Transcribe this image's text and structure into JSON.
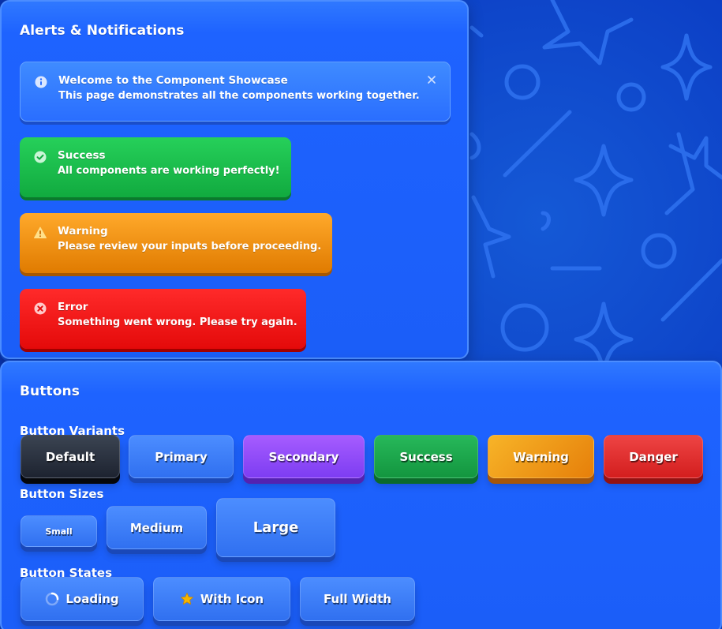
{
  "alerts_panel": {
    "title": "Alerts & Notifications",
    "alerts": [
      {
        "type": "info",
        "icon": "info-icon",
        "title": "Welcome to the Component Showcase",
        "message": "This page demonstrates all the components working together.",
        "dismissible": true
      },
      {
        "type": "success",
        "icon": "check-circle-icon",
        "title": "Success",
        "message": "All components are working perfectly!"
      },
      {
        "type": "warning",
        "icon": "warning-triangle-icon",
        "title": "Warning",
        "message": "Please review your inputs before proceeding."
      },
      {
        "type": "error",
        "icon": "x-circle-icon",
        "title": "Error",
        "message": "Something went wrong. Please try again."
      }
    ]
  },
  "buttons_panel": {
    "title": "Buttons",
    "variants": {
      "heading": "Button Variants",
      "buttons": [
        "Default",
        "Primary",
        "Secondary",
        "Success",
        "Warning",
        "Danger"
      ]
    },
    "sizes": {
      "heading": "Button Sizes",
      "buttons": [
        "Small",
        "Medium",
        "Large"
      ]
    },
    "states": {
      "heading": "Button States",
      "buttons": [
        {
          "label": "Loading",
          "icon": "spinner-icon"
        },
        {
          "label": "With Icon",
          "icon": "star-icon"
        },
        {
          "label": "Full Width"
        }
      ]
    }
  },
  "colors": {
    "info": "#2a6eff",
    "success": "#11aa3f",
    "warning": "#e07b00",
    "error": "#e40a0a",
    "primary": "#3070f0",
    "secondary": "#7d3df2",
    "default": "#1d2330",
    "star": "#f7b500"
  }
}
